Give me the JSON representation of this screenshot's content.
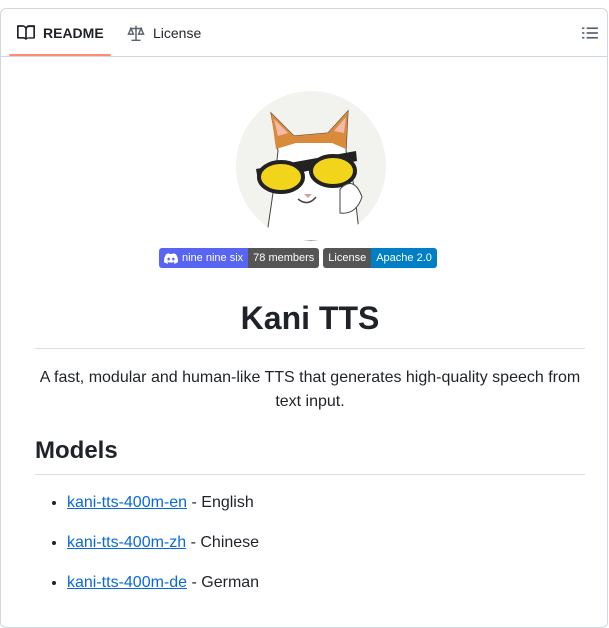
{
  "tabs": [
    {
      "label": "README",
      "icon": "book-icon",
      "active": true
    },
    {
      "label": "License",
      "icon": "scale-icon",
      "active": false
    }
  ],
  "badges": {
    "discord": {
      "label": "nine nine six",
      "value": "78 members",
      "icon": "discord-icon",
      "label_color": "#5865f2",
      "value_color": "#555555"
    },
    "license": {
      "label": "License",
      "value": "Apache 2.0",
      "label_color": "#555555",
      "value_color": "#007ec6"
    }
  },
  "readme": {
    "title": "Kani TTS",
    "description": "A fast, modular and human-like TTS that generates high-quality speech from text input.",
    "models_heading": "Models",
    "models": [
      {
        "link": "kani-tts-400m-en",
        "language": " - English"
      },
      {
        "link": "kani-tts-400m-zh",
        "language": " - Chinese"
      },
      {
        "link": "kani-tts-400m-de",
        "language": " - German"
      }
    ]
  },
  "colors": {
    "accent_underline": "#fd8c73",
    "link": "#0969da"
  }
}
